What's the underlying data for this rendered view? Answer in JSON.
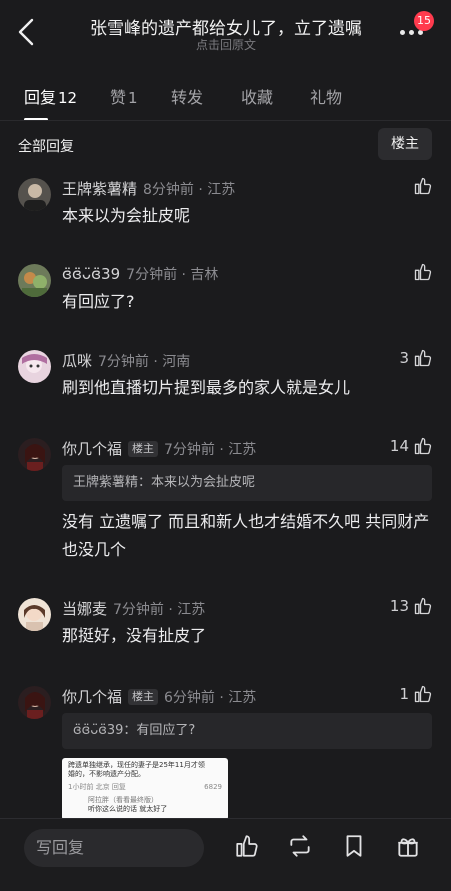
{
  "header": {
    "title": "张雪峰的遗产都给女儿了，立了遗嘱",
    "subtitle": "点击回原文",
    "notification_count": "15"
  },
  "tabs": [
    {
      "label": "回复",
      "count": "12"
    },
    {
      "label": "赞",
      "count": "1"
    },
    {
      "label": "转发",
      "count": ""
    },
    {
      "label": "收藏",
      "count": ""
    },
    {
      "label": "礼物",
      "count": ""
    }
  ],
  "section": {
    "all_replies": "全部回复",
    "owner_filter": "楼主"
  },
  "comments": [
    {
      "user": "王牌紫薯精",
      "meta": "8分钟前 · 江苏",
      "text": "本来以为会扯皮呢",
      "likes": ""
    },
    {
      "user": "ɞ̈ɞ̈ᴗ̈ɞ̈39",
      "meta": "7分钟前 · 吉林",
      "text": "有回应了?",
      "likes": ""
    },
    {
      "user": "瓜咪",
      "meta": "7分钟前 · 河南",
      "text": "刷到他直播切片提到最多的家人就是女儿",
      "likes": "3"
    },
    {
      "user": "你几个福",
      "tag": "楼主",
      "meta": "7分钟前 · 江苏",
      "quote": "王牌紫薯精：本来以为会扯皮呢",
      "text": "没有 立遗嘱了 而且和新人也才结婚不久吧 共同财产也没几个",
      "likes": "14"
    },
    {
      "user": "当娜麦",
      "meta": "7分钟前 · 江苏",
      "text": "那挺好，没有扯皮了",
      "likes": "13"
    },
    {
      "user": "你几个福",
      "tag": "楼主",
      "meta": "6分钟前 · 江苏",
      "quote": "ɞ̈ɞ̈ᴗ̈ɞ̈39：有回应了?",
      "likes": "1",
      "image": {
        "line1": "跨遗单独继承，现任的妻子是25年11月才领",
        "line2": "婚的，不影响遗产分配。",
        "meta": "1小时前 北京  回复",
        "likes": "6829",
        "reply_user": "阿拉胖（看看最终版）",
        "reply_text": "听你这么说的话 就太好了"
      }
    }
  ],
  "bottom": {
    "reply_placeholder": "写回复",
    "icons": [
      "thumbs-up-icon",
      "repost-icon",
      "bookmark-icon",
      "gift-icon"
    ]
  },
  "colors": {
    "background": "#1b1b1d",
    "badge": "#ff3b4e"
  }
}
